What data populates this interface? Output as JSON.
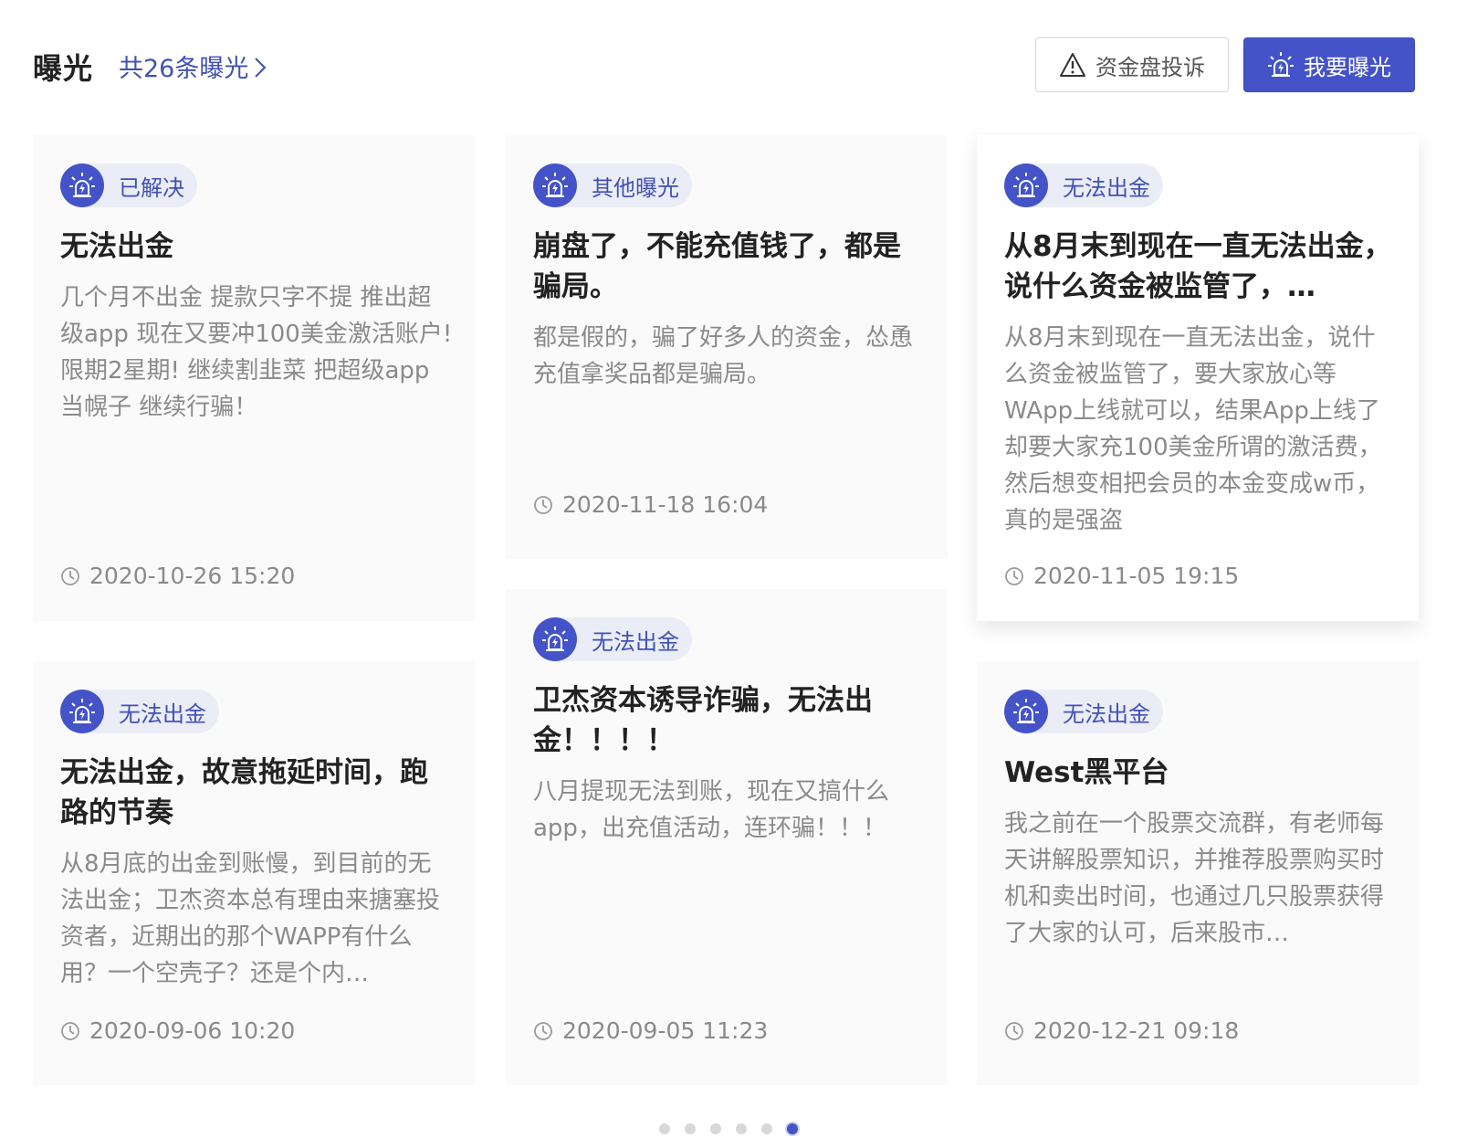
{
  "header": {
    "title": "曝光",
    "count_link": "共26条曝光",
    "complain_button": "资金盘投诉",
    "expose_button": "我要曝光"
  },
  "cards": [
    {
      "tag": "已解决",
      "title": "无法出金",
      "description": "几个月不出金 提款只字不提 推出超级app 现在又要冲100美金激活账户! 限期2星期! 继续割韭菜 把超级app当幌子 继续行骗！",
      "time": "2020-10-26 15:20"
    },
    {
      "tag": "其他曝光",
      "title": "崩盘了，不能充值钱了，都是骗局。",
      "description": "都是假的，骗了好多人的资金，怂恿充值拿奖品都是骗局。",
      "time": "2020-11-18 16:04"
    },
    {
      "tag": "无法出金",
      "title": "从8月末到现在一直无法出金，说什么资金被监管了，…",
      "description": "从8月末到现在一直无法出金，说什么资金被监管了，要大家放心等WApp上线就可以，结果App上线了却要大家充100美金所谓的激活费，然后想变相把会员的本金变成w币，真的是强盗",
      "time": "2020-11-05 19:15"
    },
    {
      "tag": "无法出金",
      "title": "无法出金，故意拖延时间，跑路的节奏",
      "description": "从8月底的出金到账慢，到目前的无法出金；卫杰资本总有理由来搪塞投资者，近期出的那个WAPP有什么用？一个空壳子？还是个内…",
      "time": "2020-09-06 10:20"
    },
    {
      "tag": "无法出金",
      "title": "卫杰资本诱导诈骗，无法出金！！！！",
      "description": "八月提现无法到账，现在又搞什么app，出充值活动，连环骗！！！",
      "time": "2020-09-05 11:23"
    },
    {
      "tag": "无法出金",
      "title": "West黑平台",
      "description": "我之前在一个股票交流群，有老师每天讲解股票知识，并推荐股票购买时机和卖出时间，也通过几只股票获得了大家的认可，后来股市…",
      "time": "2020-12-21 09:18"
    }
  ],
  "pagination": {
    "total": 6,
    "active_index": 5
  },
  "colors": {
    "accent": "#4453c7",
    "tag_bg": "#ebedf6",
    "card_bg": "#fafafa"
  },
  "icons": {
    "tag_badge": "alarm-light-icon",
    "time": "clock-icon",
    "complain": "warning-triangle-icon",
    "chevron": "chevron-right-icon"
  }
}
